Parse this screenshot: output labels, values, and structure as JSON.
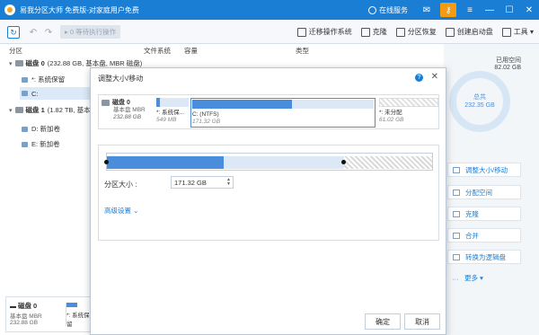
{
  "app": {
    "title": "易我分区大师 免费版-对家庭用户免费",
    "online_service": "在线服务"
  },
  "toolbar": {
    "pending_label": "0 等待执行操作",
    "tools": [
      "迁移操作系统",
      "克隆",
      "分区恢复",
      "创建启动盘",
      "工具"
    ]
  },
  "table_headers": {
    "partition": "分区",
    "filesystem": "文件系统",
    "capacity": "容量",
    "type": "类型"
  },
  "tree": {
    "disk0": {
      "name": "磁盘 0",
      "info": "(232.88 GB, 基本盘, MBR 磁盘)"
    },
    "disk0_parts": [
      "*: 系统保留",
      "C:"
    ],
    "disk1": {
      "name": "磁盘 1",
      "info": "(1.82 TB, 基本盘, MBR 磁盘)"
    },
    "disk1_parts": [
      "D: 新加卷",
      "E: 新加卷"
    ]
  },
  "bottom_map": {
    "disk_name": "磁盘 0",
    "disk_type": "基本盘 MBR",
    "disk_size": "232.88 GB",
    "part_name": "*: 系统保留"
  },
  "right_panel": {
    "used_label": "已用空间",
    "used_value": "82.02 GB",
    "total_label": "总共",
    "total_value": "232.35 GB",
    "actions": [
      "调整大小/移动",
      "分配空间",
      "克隆",
      "合并",
      "转换为逻辑盘",
      "更多"
    ]
  },
  "dialog": {
    "title": "调整大小/移动",
    "disk_name": "磁盘 0",
    "disk_type": "基本盘 MBR",
    "disk_size": "232.88 GB",
    "partitions": [
      {
        "name": "*: 系统保...",
        "size": "549 MB"
      },
      {
        "name": "C: (NTFS)",
        "size": "171.32 GB"
      },
      {
        "name": "*: 未分配",
        "size": "61.02 GB"
      }
    ],
    "c_used_fraction": 0.55,
    "resize_used_fraction": 0.36,
    "resize_partition_fraction": 0.73,
    "size_label": "分区大小 :",
    "size_value": "171.32 GB",
    "advanced_label": "高级设置",
    "ok_label": "确定",
    "cancel_label": "取消"
  }
}
